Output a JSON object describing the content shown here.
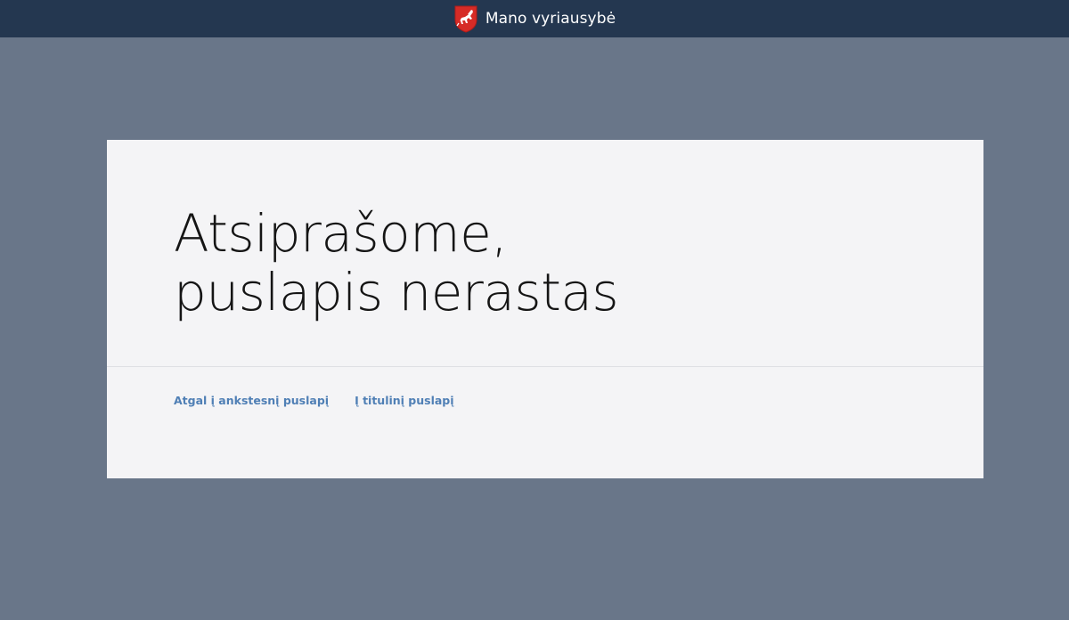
{
  "header": {
    "site_title": "Mano vyriausybė",
    "logo_icon": "coat-of-arms-vytis-icon"
  },
  "error": {
    "title_line1": "Atsiprašome,",
    "title_line2": "puslapis nerastas"
  },
  "links": {
    "back": "Atgal į ankstesnį puslapį",
    "home": "Į titulinį puslapį"
  },
  "colors": {
    "header_bg": "#243750",
    "page_bg": "#697689",
    "card_bg": "#f4f4f6",
    "link": "#4f7fb5",
    "shield_red": "#d62b26"
  }
}
